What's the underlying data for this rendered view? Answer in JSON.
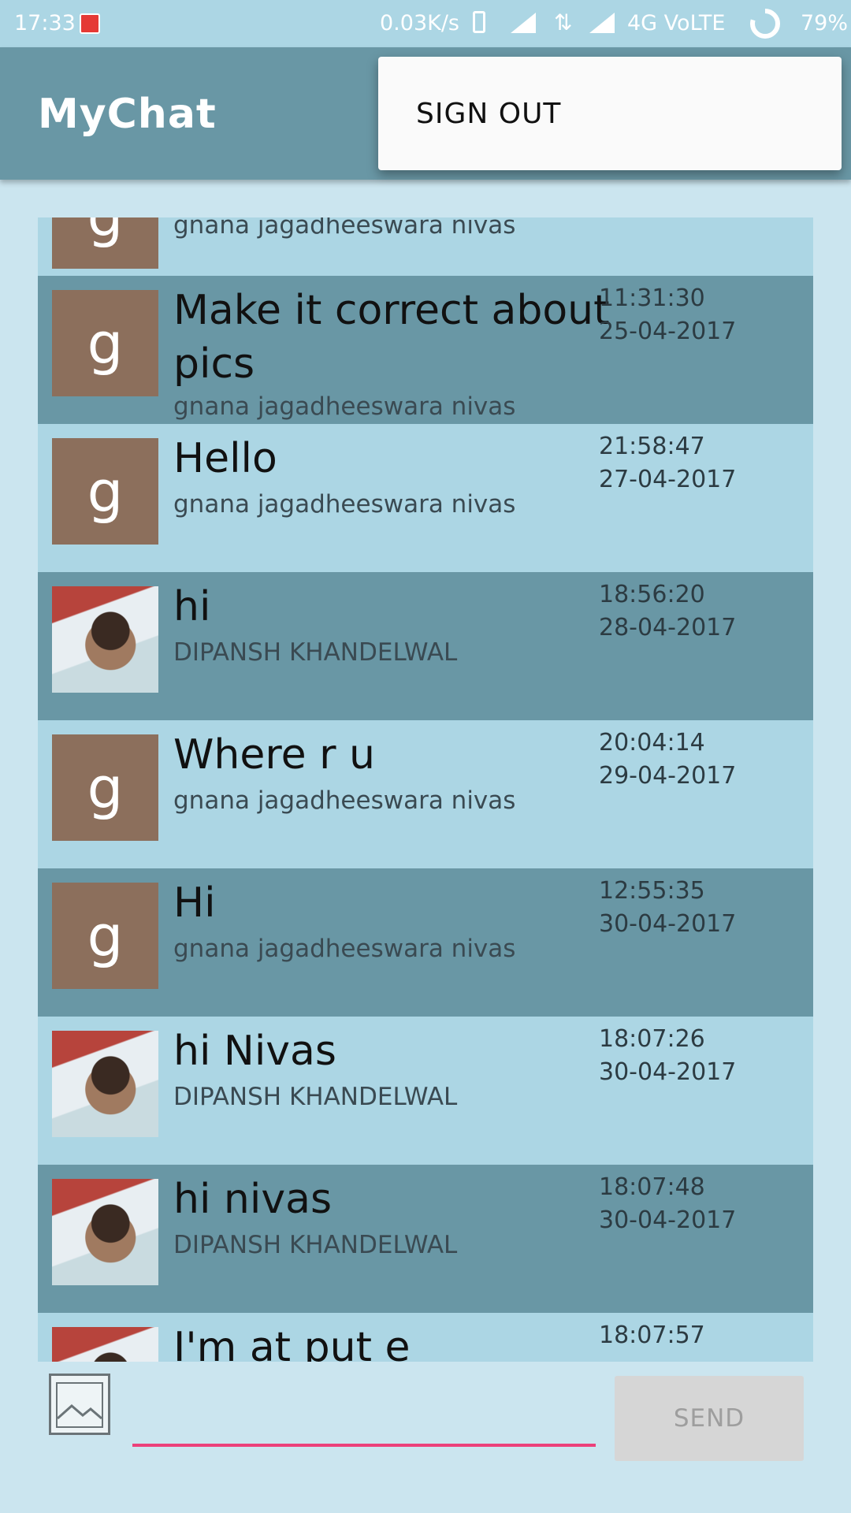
{
  "status_bar": {
    "time": "17:33",
    "speed": "0.03K/s",
    "network": "4G VoLTE",
    "battery": "79%"
  },
  "app_bar": {
    "title": "MyChat"
  },
  "menu": {
    "sign_out": "SIGN OUT"
  },
  "messages": [
    {
      "text": "",
      "sender": "gnana jagadheeswara nivas",
      "time": "",
      "date": "",
      "avatar": "g"
    },
    {
      "text": "Make it correct about pics",
      "sender": "gnana jagadheeswara nivas",
      "time": "11:31:30",
      "date": "25-04-2017",
      "avatar": "g"
    },
    {
      "text": "Hello",
      "sender": "gnana jagadheeswara nivas",
      "time": "21:58:47",
      "date": "27-04-2017",
      "avatar": "g"
    },
    {
      "text": "hi",
      "sender": "DIPANSH KHANDELWAL",
      "time": "18:56:20",
      "date": "28-04-2017",
      "avatar": "photo"
    },
    {
      "text": "Where r u",
      "sender": "gnana jagadheeswara nivas",
      "time": "20:04:14",
      "date": "29-04-2017",
      "avatar": "g"
    },
    {
      "text": "Hi",
      "sender": "gnana jagadheeswara nivas",
      "time": "12:55:35",
      "date": "30-04-2017",
      "avatar": "g"
    },
    {
      "text": "hi Nivas",
      "sender": "DIPANSH KHANDELWAL",
      "time": "18:07:26",
      "date": "30-04-2017",
      "avatar": "photo"
    },
    {
      "text": "hi nivas",
      "sender": "DIPANSH KHANDELWAL",
      "time": "18:07:48",
      "date": "30-04-2017",
      "avatar": "photo"
    },
    {
      "text": "I'm at put e",
      "sender": "",
      "time": "18:07:57",
      "date": "",
      "avatar": "photo"
    }
  ],
  "composer": {
    "placeholder": "",
    "send_label": "SEND"
  },
  "colors": {
    "app_bar": "#6997a5",
    "row_light": "#acd6e4",
    "row_dark": "#6997a5",
    "input_underline": "#ec407a"
  }
}
